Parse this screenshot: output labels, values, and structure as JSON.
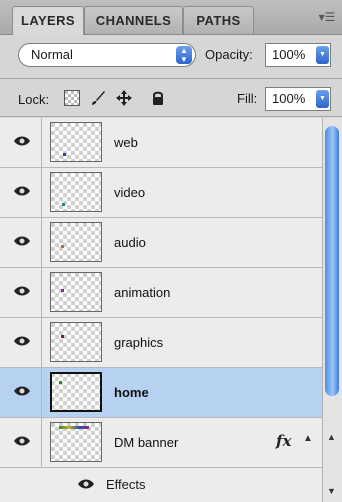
{
  "tabs": [
    {
      "label": "LAYERS",
      "active": true
    },
    {
      "label": "CHANNELS",
      "active": false
    },
    {
      "label": "PATHS",
      "active": false
    }
  ],
  "panel_menu_icon": "panel-menu-icon",
  "blend": {
    "mode": "Normal",
    "opacity_label": "Opacity:",
    "opacity_value": "100%"
  },
  "lock": {
    "label": "Lock:",
    "fill_label": "Fill:",
    "fill_value": "100%"
  },
  "layers": [
    {
      "name": "web",
      "visible": true,
      "selected": false,
      "dot_color": "#2a3fa8"
    },
    {
      "name": "video",
      "visible": true,
      "selected": false,
      "dot_color": "#1f8b8b"
    },
    {
      "name": "audio",
      "visible": true,
      "selected": false,
      "dot_color": "#b0702a"
    },
    {
      "name": "animation",
      "visible": true,
      "selected": false,
      "dot_color": "#8a2a8a"
    },
    {
      "name": "graphics",
      "visible": true,
      "selected": false,
      "dot_color": "#7a1f3a"
    },
    {
      "name": "home",
      "visible": true,
      "selected": true,
      "dot_color": "#2a8a2a"
    },
    {
      "name": "DM banner",
      "visible": true,
      "selected": false,
      "has_fx": true
    }
  ],
  "effects_label": "Effects",
  "colors": {
    "selection": "#b7d1f0",
    "accent": "#3c7ed9"
  }
}
